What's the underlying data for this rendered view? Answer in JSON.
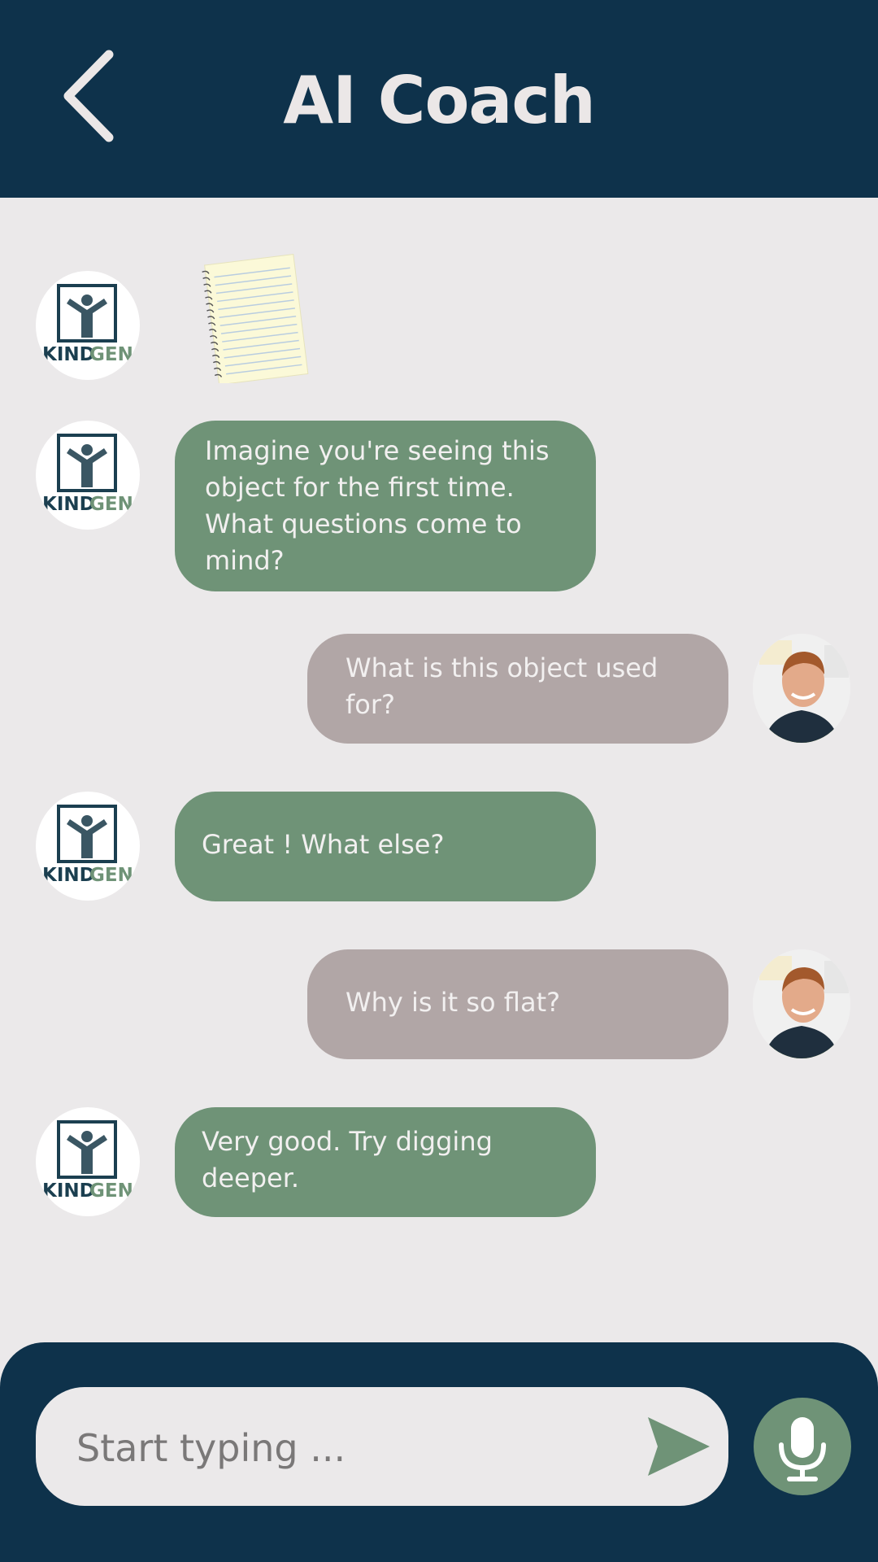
{
  "header": {
    "title": "AI Coach",
    "back_icon": "chevron-left-icon"
  },
  "coach": {
    "logo_text_primary": "KIND",
    "logo_text_secondary": "GEN"
  },
  "messages": [
    {
      "from": "coach",
      "type": "image",
      "image": "notepad-image"
    },
    {
      "from": "coach",
      "type": "text",
      "text": "Imagine you're seeing this object for the first time. What questions come to mind?"
    },
    {
      "from": "user",
      "type": "text",
      "text": "What is this object used for?"
    },
    {
      "from": "coach",
      "type": "text",
      "text": "Great ! What else?"
    },
    {
      "from": "user",
      "type": "text",
      "text": "Why is it so flat?"
    },
    {
      "from": "coach",
      "type": "text",
      "text": "Very good. Try digging deeper."
    }
  ],
  "composer": {
    "placeholder": "Start typing ...",
    "send_icon": "send-icon",
    "mic_icon": "microphone-icon"
  },
  "colors": {
    "header_bg": "#0e324b",
    "page_bg": "#ebe9ea",
    "coach_bubble": "#6f9377",
    "user_bubble": "#b1a6a6",
    "text_light": "#f2f0f0"
  }
}
